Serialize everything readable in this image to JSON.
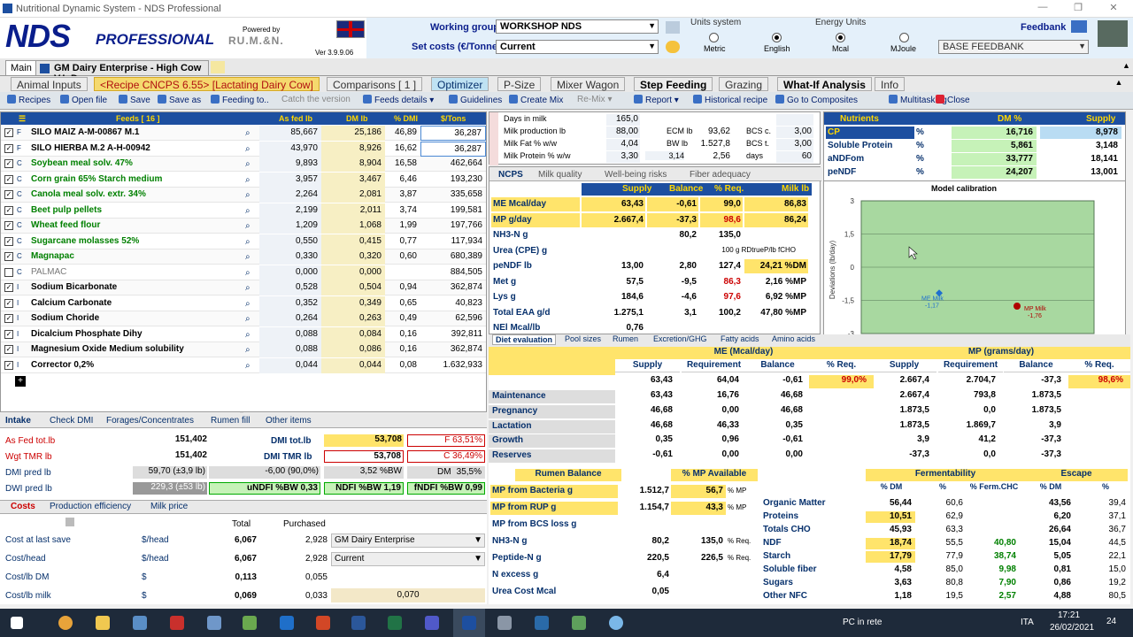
{
  "window": {
    "title": "Nutritional Dynamic System - NDS Professional"
  },
  "header": {
    "logo": "NDS",
    "logo_sub": "PROFESSIONAL",
    "powered": "Powered by",
    "rumen": "RU.M.&N.",
    "version": "Ver 3.9.9.06",
    "working_group_label": "Working group",
    "working_group_value": "WORKSHOP NDS",
    "set_costs_label": "Set costs (€/Tonne)",
    "set_costs_value": "Current",
    "units_system_label": "Units system",
    "unit_metric": "Metric",
    "unit_english": "English",
    "energy_units_label": "Energy Units",
    "energy_mcal": "Mcal",
    "energy_mjoule": "MJoule",
    "feedback_label": "Feedbank",
    "feedback_value": "BASE FEEDBANK"
  },
  "tabs_top": {
    "main": "Main",
    "enterprise": "GM Dairy Enterprise - High Cow V.L D"
  },
  "main_tabs": [
    "Animal Inputs",
    "<Recipe CNCPS 6.55> [Lactating Dairy Cow]",
    "Comparisons [ 1 ]",
    "Optimizer",
    "P-Size",
    "Mixer Wagon",
    "Step Feeding",
    "Grazing",
    "What-If Analysis",
    "Info"
  ],
  "toolbar": [
    "Recipes",
    "Open file",
    "Save",
    "Save as",
    "Feeding to..",
    "Catch the version",
    "Feeds details",
    "Re-Mix",
    "Create Mix",
    "Guidelines",
    "Report",
    "Historical recipe",
    "Go to Composites",
    "Multitasking",
    "Close"
  ],
  "feeds": {
    "headers": [
      "Feeds [ 16 ]",
      "As fed lb",
      "DM lb",
      "% DMI",
      "$/Tons"
    ],
    "rows": [
      {
        "c": "F",
        "name": "SILO MAIZ A-M-00867 M.1",
        "asfed": "85,667",
        "dm": "25,186",
        "dmi": "46,89",
        "cost": "36,287",
        "checked": true
      },
      {
        "c": "F",
        "name": "SILO HIERBA M.2 A-H-00942",
        "asfed": "43,970",
        "dm": "8,926",
        "dmi": "16,62",
        "cost": "36,287",
        "checked": true
      },
      {
        "c": "C",
        "name": "Soybean meal solv. 47%",
        "asfed": "9,893",
        "dm": "8,904",
        "dmi": "16,58",
        "cost": "462,664",
        "checked": true
      },
      {
        "c": "C",
        "name": "Corn grain 65% Starch medium",
        "asfed": "3,957",
        "dm": "3,467",
        "dmi": "6,46",
        "cost": "193,230",
        "checked": true
      },
      {
        "c": "C",
        "name": "Canola meal solv. extr. 34%",
        "asfed": "2,264",
        "dm": "2,081",
        "dmi": "3,87",
        "cost": "335,658",
        "checked": true
      },
      {
        "c": "C",
        "name": "Beet pulp pellets",
        "asfed": "2,199",
        "dm": "2,011",
        "dmi": "3,74",
        "cost": "199,581",
        "checked": true
      },
      {
        "c": "C",
        "name": "Wheat feed flour",
        "asfed": "1,209",
        "dm": "1,068",
        "dmi": "1,99",
        "cost": "197,766",
        "checked": true
      },
      {
        "c": "C",
        "name": "Sugarcane molasses 52%",
        "asfed": "0,550",
        "dm": "0,415",
        "dmi": "0,77",
        "cost": "117,934",
        "checked": true
      },
      {
        "c": "C",
        "name": "Magnapac",
        "asfed": "0,330",
        "dm": "0,320",
        "dmi": "0,60",
        "cost": "680,389",
        "checked": true
      },
      {
        "c": "C",
        "name": "PALMAC",
        "asfed": "0,000",
        "dm": "0,000",
        "dmi": "",
        "cost": "884,505",
        "checked": false
      },
      {
        "c": "I",
        "name": "Sodium Bicarbonate",
        "asfed": "0,528",
        "dm": "0,504",
        "dmi": "0,94",
        "cost": "362,874",
        "checked": true
      },
      {
        "c": "I",
        "name": "Calcium Carbonate",
        "asfed": "0,352",
        "dm": "0,349",
        "dmi": "0,65",
        "cost": "40,823",
        "checked": true
      },
      {
        "c": "I",
        "name": "Sodium Choride",
        "asfed": "0,264",
        "dm": "0,263",
        "dmi": "0,49",
        "cost": "62,596",
        "checked": true
      },
      {
        "c": "I",
        "name": "Dicalcium Phosphate Dihy",
        "asfed": "0,088",
        "dm": "0,084",
        "dmi": "0,16",
        "cost": "392,811",
        "checked": true
      },
      {
        "c": "I",
        "name": "Magnesium Oxide Medium solubility",
        "asfed": "0,088",
        "dm": "0,086",
        "dmi": "0,16",
        "cost": "362,874",
        "checked": true
      },
      {
        "c": "I",
        "name": "Corrector 0,2%",
        "asfed": "0,044",
        "dm": "0,044",
        "dmi": "0,08",
        "cost": "1.632,933",
        "checked": true
      }
    ]
  },
  "intake": {
    "tabs": [
      "Intake",
      "Check DMI",
      "Forages/Concentrates",
      "Rumen fill",
      "Other items"
    ],
    "asfed_label": "As Fed tot.lb",
    "asfed": "151,402",
    "dmi_label": "DMI tot.lb",
    "dmi": "53,708",
    "f_pct": "F 63,51%",
    "wgt_label": "Wgt TMR lb",
    "wgt": "151,402",
    "dmi_tmr_label": "DMI TMR lb",
    "dmi_tmr": "53,708",
    "c_pct": "C 36,49%",
    "dmi_pred_label": "DMI pred lb",
    "dmi_pred": "59,70 (±3,9 lb)",
    "dmi_pred2": "-6,00 (90,0%)",
    "bw_pct": "3,52 %BW",
    "dm_label": "DM",
    "dm_pct": "35,5%",
    "dwi_label": "DWI pred lb",
    "dwi": "229,3 (±53 lb)",
    "undf": "uNDFI %BW 0,33",
    "ndfi": "NDFI %BW 1,19",
    "fndfi": "fNDFI %BW 0,99"
  },
  "costs": {
    "tabs": [
      "Costs",
      "Production efficiency",
      "Milk price"
    ],
    "total": "Total",
    "purchased": "Purchased",
    "rows": [
      {
        "label": "Cost at last save",
        "unit": "$/head",
        "total": "6,067",
        "purchased": "2,928"
      },
      {
        "label": "Cost/head",
        "unit": "$/head",
        "total": "6,067",
        "purchased": "2,928"
      },
      {
        "label": "Cost/lb DM",
        "unit": "$",
        "total": "0,113",
        "purchased": "0,055"
      },
      {
        "label": "Cost/lb milk",
        "unit": "$",
        "total": "0,069",
        "purchased": "0,033"
      }
    ],
    "combo1": "GM Dairy Enterprise",
    "combo2": "Current",
    "milk_cost": "0,070"
  },
  "animal": {
    "rows": [
      {
        "l": "Days in milk",
        "v": "165,0",
        "l2": "",
        "v2": "",
        "l3": "",
        "v3": ""
      },
      {
        "l": "Milk production lb",
        "v": "88,00",
        "l2": "ECM lb",
        "v2": "93,62",
        "l3": "BCS c.",
        "v3": "3,00"
      },
      {
        "l": "Milk Fat % w/w",
        "v": "4,04",
        "l2": "BW lb",
        "v2": "1.527,8",
        "l3": "BCS t.",
        "v3": "3,00"
      },
      {
        "l": "Milk Protein % w/w",
        "v": "3,30",
        "l2": "3,14",
        "v2": "2,56",
        "l3": "days",
        "v3": "60"
      }
    ]
  },
  "ncps": {
    "tabs": [
      "NCPS",
      "Milk quality",
      "Well-being risks",
      "Fiber adequacy"
    ],
    "headers": [
      "Supply",
      "Balance",
      "% Req.",
      "Milk lb"
    ],
    "rows": [
      {
        "l": "ME Mcal/day",
        "s": "63,43",
        "b": "-0,61",
        "r": "99,0",
        "m": "86,83"
      },
      {
        "l": "MP g/day",
        "s": "2.667,4",
        "b": "-37,3",
        "r": "98,6",
        "m": "86,24"
      },
      {
        "l": "NH3-N g",
        "s": "",
        "b": "80,2",
        "r": "135,0",
        "m": ""
      },
      {
        "l": "Urea (CPE) g",
        "s": "",
        "b": "",
        "r": "100 g RDtrueP/lb fCHO",
        "m": ""
      },
      {
        "l": "peNDF lb",
        "s": "13,00",
        "b": "2,80",
        "r": "127,4",
        "m": "24,21 %DM"
      },
      {
        "l": "Met g",
        "s": "57,5",
        "b": "-9,5",
        "r": "86,3",
        "m": "2,16 %MP"
      },
      {
        "l": "Lys g",
        "s": "184,6",
        "b": "-4,6",
        "r": "97,6",
        "m": "6,92 %MP"
      },
      {
        "l": "Total EAA g/d",
        "s": "1.275,1",
        "b": "3,1",
        "r": "100,2",
        "m": "47,80 %MP"
      },
      {
        "l": "NEl Mcal/lb",
        "s": "0,76",
        "b": "",
        "r": "",
        "m": ""
      }
    ]
  },
  "nutrients": {
    "headers": [
      "Nutrients",
      "DM %",
      "Supply"
    ],
    "rows": [
      {
        "n": "CP",
        "u": "%",
        "dm": "16,716",
        "s": "8,978"
      },
      {
        "n": "Soluble Protein",
        "u": "%",
        "dm": "5,861",
        "s": "3,148"
      },
      {
        "n": "aNDFom",
        "u": "%",
        "dm": "33,777",
        "s": "18,141"
      },
      {
        "n": "peNDF",
        "u": "%",
        "dm": "24,207",
        "s": "13,001"
      }
    ]
  },
  "chart_data": {
    "type": "scatter",
    "title": "Model calibration",
    "ylabel": "Deviations (lb/day)",
    "ylim": [
      -3,
      3
    ],
    "y_ticks": [
      "3",
      "1,5",
      "0",
      "-1,5",
      "-3"
    ],
    "series": [
      {
        "name": "ME Milk",
        "values": [
          -1.17
        ],
        "label": "-1,17",
        "color": "#1e6fd0"
      },
      {
        "name": "MP Milk",
        "values": [
          -1.76
        ],
        "label": "-1,76",
        "color": "#b00000"
      }
    ]
  },
  "diet": {
    "tabs": [
      "Diet evaluation",
      "Pool sizes",
      "Rumen",
      "Excretion/GHG",
      "Fatty acids",
      "Amino acids"
    ],
    "me_title": "ME (Mcal/day)",
    "mp_title": "MP (grams/day)",
    "cols": [
      "Supply",
      "Requirement",
      "Balance",
      "% Req.",
      "Supply",
      "Requirement",
      "Balance",
      "% Req."
    ],
    "total": [
      "63,43",
      "64,04",
      "-0,61",
      "99,0%",
      "2.667,4",
      "2.704,7",
      "-37,3",
      "98,6%"
    ],
    "rows": [
      {
        "l": "Maintenance",
        "v": [
          "63,43",
          "16,76",
          "46,68",
          "",
          "2.667,4",
          "793,8",
          "1.873,5",
          ""
        ]
      },
      {
        "l": "Pregnancy",
        "v": [
          "46,68",
          "0,00",
          "46,68",
          "",
          "1.873,5",
          "0,0",
          "1.873,5",
          ""
        ]
      },
      {
        "l": "Lactation",
        "v": [
          "46,68",
          "46,33",
          "0,35",
          "",
          "1.873,5",
          "1.869,7",
          "3,9",
          ""
        ]
      },
      {
        "l": "Growth",
        "v": [
          "0,35",
          "0,96",
          "-0,61",
          "",
          "3,9",
          "41,2",
          "-37,3",
          ""
        ]
      },
      {
        "l": "Reserves",
        "v": [
          "-0,61",
          "0,00",
          "0,00",
          "",
          "-37,3",
          "0,0",
          "-37,3",
          ""
        ]
      }
    ]
  },
  "rumen": {
    "title": "Rumen Balance",
    "mp_avail": "% MP Available",
    "rows": [
      {
        "l": "MP from Bacteria g",
        "v": "1.512,7",
        "p": "56,7",
        "u": "% MP"
      },
      {
        "l": "MP from RUP g",
        "v": "1.154,7",
        "p": "43,3",
        "u": "% MP"
      },
      {
        "l": "MP from BCS loss g",
        "v": "",
        "p": "",
        "u": ""
      },
      {
        "l": "NH3-N g",
        "v": "80,2",
        "p": "135,0",
        "u": "% Req."
      },
      {
        "l": "Peptide-N g",
        "v": "220,5",
        "p": "226,5",
        "u": "% Req."
      },
      {
        "l": "N excess g",
        "v": "6,4",
        "p": "",
        "u": ""
      },
      {
        "l": "Urea Cost Mcal",
        "v": "0,05",
        "p": "",
        "u": ""
      }
    ]
  },
  "ferment": {
    "title1": "Fermentability",
    "title2": "Escape",
    "cols": [
      "% DM",
      "%",
      "% Ferm.CHC",
      "% DM",
      "%"
    ],
    "rows": [
      {
        "l": "Organic Matter",
        "v": [
          "56,44",
          "60,6",
          "",
          "43,56",
          "39,4"
        ]
      },
      {
        "l": "Proteins",
        "v": [
          "10,51",
          "62,9",
          "",
          "6,20",
          "37,1"
        ]
      },
      {
        "l": "Totals CHO",
        "v": [
          "45,93",
          "63,3",
          "",
          "26,64",
          "36,7"
        ]
      },
      {
        "l": "NDF",
        "v": [
          "18,74",
          "55,5",
          "40,80",
          "15,04",
          "44,5"
        ]
      },
      {
        "l": "Starch",
        "v": [
          "17,79",
          "77,9",
          "38,74",
          "5,05",
          "22,1"
        ]
      },
      {
        "l": "Soluble fiber",
        "v": [
          "4,58",
          "85,0",
          "9,98",
          "0,81",
          "15,0"
        ]
      },
      {
        "l": "Sugars",
        "v": [
          "3,63",
          "80,8",
          "7,90",
          "0,86",
          "19,2"
        ]
      },
      {
        "l": "Other NFC",
        "v": [
          "1,18",
          "19,5",
          "2,57",
          "4,88",
          "80,5"
        ]
      }
    ]
  },
  "taskbar": {
    "network": "PC in rete",
    "lang": "ITA",
    "time": "17:21",
    "date": "26/02/2021",
    "notif": "24"
  }
}
